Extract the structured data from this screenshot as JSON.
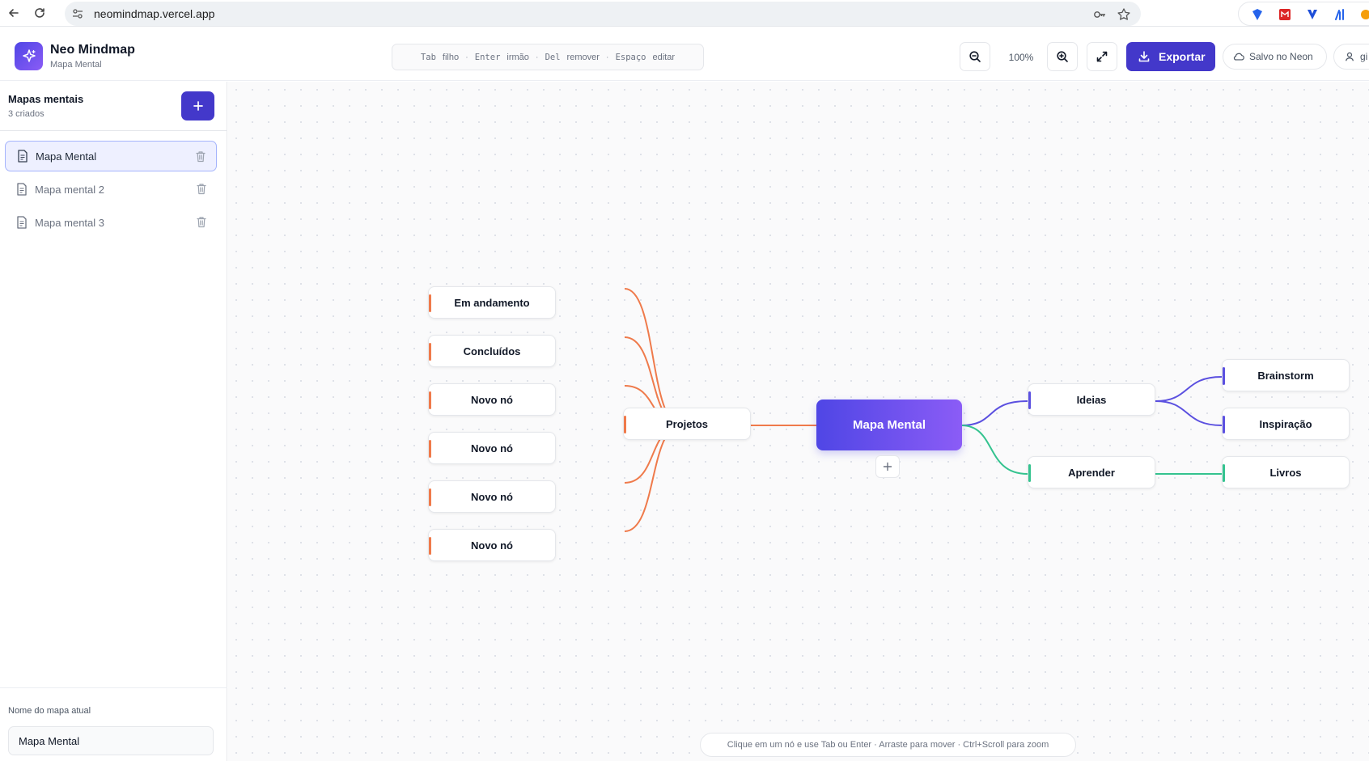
{
  "browser": {
    "url": "neomindmap.vercel.app"
  },
  "header": {
    "app_name": "Neo Mindmap",
    "app_subtitle": "Mapa Mental",
    "shortcuts": [
      {
        "key": "Tab",
        "action": "filho"
      },
      {
        "key": "Enter",
        "action": "irmão"
      },
      {
        "key": "Del",
        "action": "remover"
      },
      {
        "key": "Espaço",
        "action": "editar"
      }
    ],
    "zoom_level": "100%",
    "export_label": "Exportar",
    "saved_label": "Salvo no Neon",
    "user_label": "gi"
  },
  "sidebar": {
    "title": "Mapas mentais",
    "count": "3 criados",
    "maps": [
      {
        "label": "Mapa Mental",
        "active": true
      },
      {
        "label": "Mapa mental 2",
        "active": false
      },
      {
        "label": "Mapa mental 3",
        "active": false
      }
    ],
    "current_name_label": "Nome do mapa atual",
    "current_name_value": "Mapa Mental"
  },
  "mindmap": {
    "root": "Mapa Mental",
    "colors": {
      "orange": "#ef7a4b",
      "purple": "#5b50e0",
      "green": "#34c38f"
    },
    "left_branch": {
      "label": "Projetos",
      "children": [
        "Em andamento",
        "Concluídos",
        "Novo nó",
        "Novo nó",
        "Novo nó",
        "Novo nó"
      ]
    },
    "right_branches": [
      {
        "label": "Ideias",
        "children": [
          "Brainstorm",
          "Inspiração"
        ]
      },
      {
        "label": "Aprender",
        "children": [
          "Livros"
        ]
      }
    ]
  },
  "hint": "Clique em um nó e use Tab ou Enter · Arraste para mover · Ctrl+Scroll para zoom"
}
